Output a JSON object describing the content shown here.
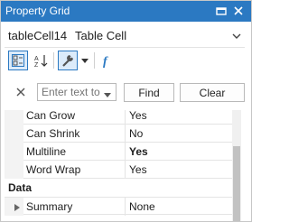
{
  "window": {
    "title": "Property Grid"
  },
  "object": {
    "name": "tableCell14",
    "type": "Table Cell"
  },
  "search": {
    "placeholder": "Enter text to"
  },
  "buttons": {
    "find": "Find",
    "clear": "Clear"
  },
  "grid": {
    "rows": [
      {
        "label": "Can Grow",
        "value": "Yes",
        "bold": false
      },
      {
        "label": "Can Shrink",
        "value": "No",
        "bold": false
      },
      {
        "label": "Multiline",
        "value": "Yes",
        "bold": true
      },
      {
        "label": "Word Wrap",
        "value": "Yes",
        "bold": false
      }
    ],
    "category": "Data",
    "summary": {
      "label": "Summary",
      "value": "None"
    }
  },
  "colors": {
    "accent": "#2b79c2",
    "title_text": "#ffffff"
  },
  "icons": [
    "pin-icon",
    "close-icon",
    "dropdown-arrow-icon",
    "categorized-view-icon",
    "alphabetical-sort-icon",
    "properties-icon",
    "expressions-icon",
    "clear-search-icon",
    "expand-icon"
  ]
}
